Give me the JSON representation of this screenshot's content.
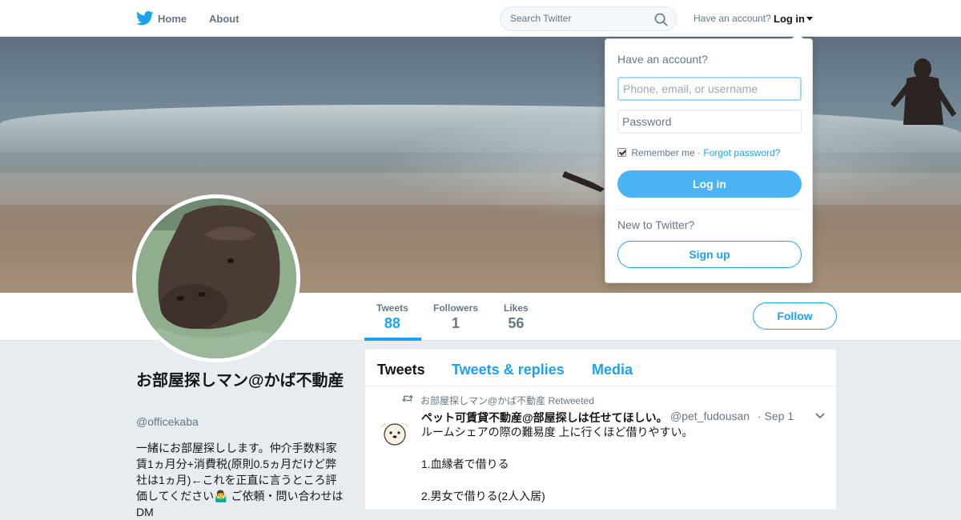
{
  "nav": {
    "logo_icon": "twitter-bird-icon",
    "home_label": "Home",
    "about_label": "About",
    "search_placeholder": "Search Twitter",
    "have_account_text": "Have an account?",
    "login_label": "Log in"
  },
  "colors": {
    "accent": "#1da1f2",
    "accent_button": "#4ab3f4",
    "muted_text": "#657786",
    "page_background": "#e6ecf0"
  },
  "profile": {
    "name": "お部屋探しマン@かば不動産",
    "handle": "@officekaba",
    "bio": "一緒にお部屋探しします。仲介手数料家賃1ヵ月分+消費税(原則0.5ヵ月だけど弊社は1ヵ月)←これを正直に言うところ評価してください🤷‍♂️ ご依頼・問い合わせはDM",
    "stats": [
      {
        "label": "Tweets",
        "value": "88"
      },
      {
        "label": "Followers",
        "value": "1"
      },
      {
        "label": "Likes",
        "value": "56"
      }
    ],
    "follow_label": "Follow"
  },
  "timeline": {
    "tabs": [
      "Tweets",
      "Tweets & replies",
      "Media"
    ],
    "tweets": [
      {
        "retweet_context": "お部屋探しマン@かば不動産 Retweeted",
        "author_name": "ペット可賃貸不動産@部屋探しは任せてほしい。",
        "author_handle": "@pet_fudousan",
        "time": "· Sep 1",
        "text": "ルームシェアの際の難易度 上に行くほど借りやすい。\n\n1.血縁者で借りる\n\n2.男女で借りる(2人入居)"
      }
    ]
  },
  "login_dropdown": {
    "title": "Have an account?",
    "username_placeholder": "Phone, email, or username",
    "password_placeholder": "Password",
    "remember_label": "Remember me ·",
    "forgot_label": "Forgot password?",
    "login_button": "Log in",
    "new_prompt": "New to Twitter?",
    "signup_button": "Sign up"
  }
}
